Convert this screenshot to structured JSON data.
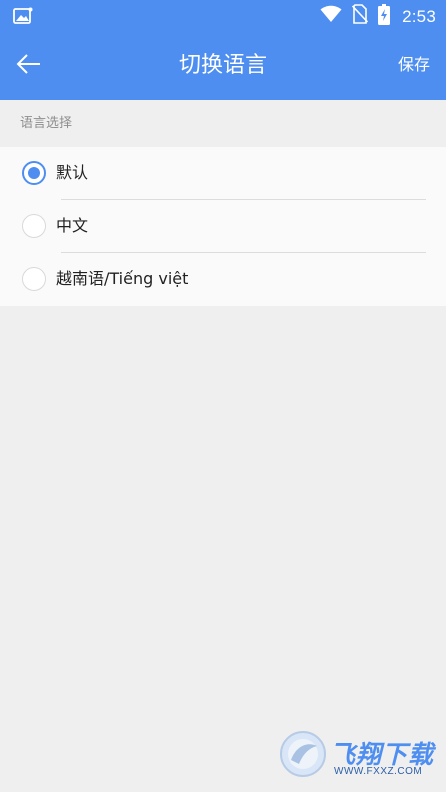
{
  "status_bar": {
    "time": "2:53",
    "left_icon": "image-icon",
    "icons": [
      "wifi-icon",
      "no-sim-icon",
      "battery-charging-icon"
    ]
  },
  "app_bar": {
    "title": "切换语言",
    "save_label": "保存",
    "back_icon": "arrow-left-icon"
  },
  "section": {
    "header": "语言选择"
  },
  "languages": [
    {
      "label": "默认",
      "selected": true
    },
    {
      "label": "中文",
      "selected": false
    },
    {
      "label": "越南语/Tiếng việt",
      "selected": false
    }
  ],
  "watermark": {
    "brand": "飞翔下载",
    "url": "WWW.FXXZ.COM"
  },
  "colors": {
    "accent": "#4d8ef0",
    "background": "#efefef",
    "list_background": "#fafafa"
  }
}
